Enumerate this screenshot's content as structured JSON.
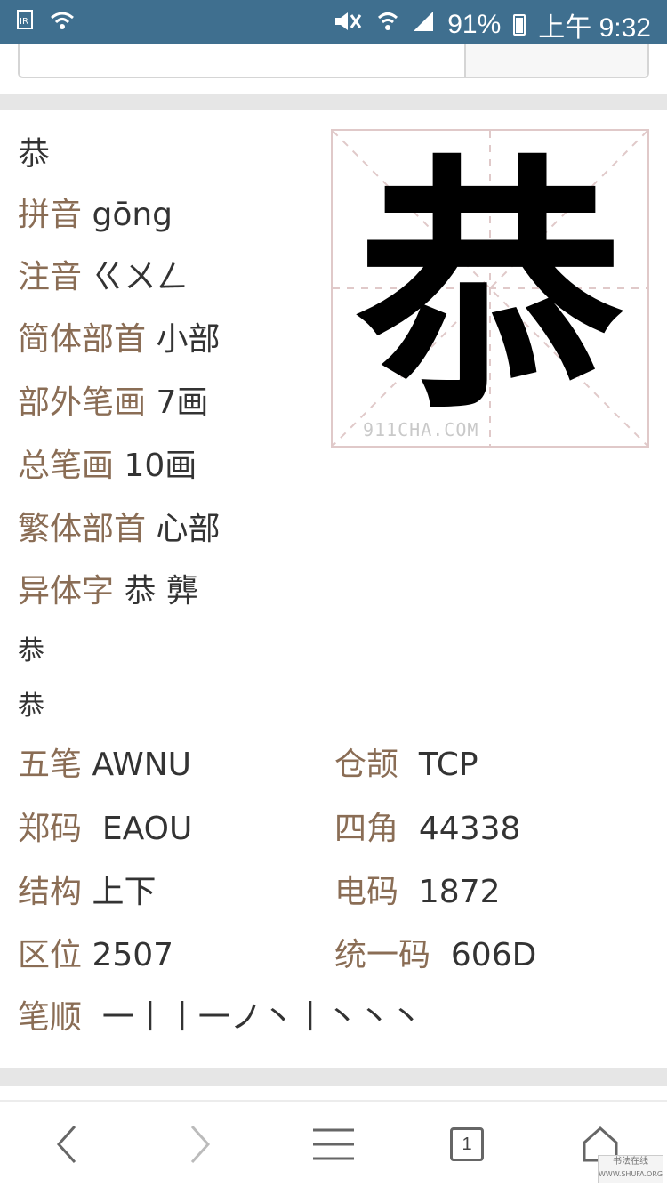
{
  "status_bar": {
    "battery": "91%",
    "time": "上午 9:32"
  },
  "entry": {
    "character": "恭",
    "pinyin": {
      "label": "拼音",
      "value": "gōng"
    },
    "zhuyin": {
      "label": "注音",
      "value": "ㄍㄨㄥ"
    },
    "simp_radical": {
      "label": "简体部首",
      "value": "小部"
    },
    "outer_strokes": {
      "label": "部外笔画",
      "value": "7画"
    },
    "total_strokes": {
      "label": "总笔画",
      "value": "10画"
    },
    "trad_radical": {
      "label": "繁体部首",
      "value": "心部"
    },
    "variants": {
      "label": "异体字",
      "value": "恭 龏"
    },
    "variant_line_1": "恭",
    "variant_line_2": "恭",
    "image_watermark": "911CHA.COM"
  },
  "codes": {
    "wubi": {
      "label": "五笔",
      "value": "AWNU"
    },
    "cangjie": {
      "label": "仓颉",
      "value": "TCP"
    },
    "zhengma": {
      "label": "郑码",
      "value": "EAOU"
    },
    "sijiao": {
      "label": "四角",
      "value": "44338"
    },
    "structure": {
      "label": "结构",
      "value": "上下"
    },
    "dianma": {
      "label": "电码",
      "value": "1872"
    },
    "quwei": {
      "label": "区位",
      "value": "2507"
    },
    "unicode": {
      "label": "统一码",
      "value": "606D"
    },
    "stroke_order": {
      "label": "笔顺",
      "value": "一丨丨一ノ丶丨丶丶丶"
    }
  },
  "bottom_nav": {
    "tab_count": "1",
    "stamp_text": "书法在线",
    "stamp_url": "WWW.SHUFA.ORG"
  }
}
